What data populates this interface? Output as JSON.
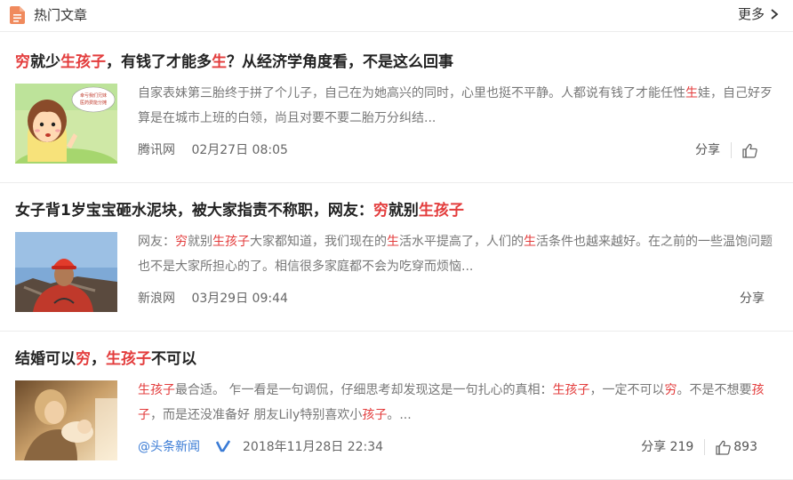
{
  "header": {
    "title": "热门文章",
    "more_label": "更多"
  },
  "colors": {
    "highlight": "#e33c3c",
    "source_link": "#3a7bd5",
    "accent_icon": "#f08a5d"
  },
  "articles": [
    {
      "title_segments": [
        {
          "text": "穷",
          "hl": true
        },
        {
          "text": "就少",
          "hl": false
        },
        {
          "text": "生孩子",
          "hl": true
        },
        {
          "text": "，有钱了才能多",
          "hl": false
        },
        {
          "text": "生",
          "hl": true
        },
        {
          "text": "？从经济学角度看，不是这么回事",
          "hl": false
        }
      ],
      "thumb_caption": "幸亏我们兄妹 医药费能分摊",
      "summary_segments": [
        {
          "text": "自家表妹第三胎终于拼了个儿子，自己在为她高兴的同时，心里也挺不平静。人都说有钱了才能任性",
          "hl": false
        },
        {
          "text": "生",
          "hl": true
        },
        {
          "text": "娃，自己好歹算是在城市上班的白领，尚且对要不要二胎万分纠结...",
          "hl": false
        }
      ],
      "source": "腾讯网",
      "time": "02月27日 08:05",
      "share_label": "分享",
      "like_count": ""
    },
    {
      "title_segments": [
        {
          "text": "女子背1岁宝宝砸水泥块，被大家指责不称职，网友：",
          "hl": false
        },
        {
          "text": "穷",
          "hl": true
        },
        {
          "text": "就别",
          "hl": false
        },
        {
          "text": "生孩子",
          "hl": true
        }
      ],
      "summary_segments": [
        {
          "text": "网友：",
          "hl": false
        },
        {
          "text": "穷",
          "hl": true
        },
        {
          "text": "就别",
          "hl": false
        },
        {
          "text": "生孩子",
          "hl": true
        },
        {
          "text": "大家都知道，我们现在的",
          "hl": false
        },
        {
          "text": "生",
          "hl": true
        },
        {
          "text": "活水平提高了，人们的",
          "hl": false
        },
        {
          "text": "生",
          "hl": true
        },
        {
          "text": "活条件也越来越好。在之前的一些温饱问题也不是大家所担心的了。相信很多家庭都不会为吃穿而烦恼...",
          "hl": false
        }
      ],
      "source": "新浪网",
      "time": "03月29日 09:44",
      "share_label": "分享"
    },
    {
      "title_segments": [
        {
          "text": "结婚可以",
          "hl": false
        },
        {
          "text": "穷",
          "hl": true
        },
        {
          "text": "，",
          "hl": false
        },
        {
          "text": "生孩子",
          "hl": true
        },
        {
          "text": "不可以",
          "hl": false
        }
      ],
      "summary_segments": [
        {
          "text": "生孩子",
          "hl": true
        },
        {
          "text": "最合适。 乍一看是一句调侃，仔细思考却发现这是一句扎心的真相：",
          "hl": false
        },
        {
          "text": "生孩子",
          "hl": true
        },
        {
          "text": "，一定不可以",
          "hl": false
        },
        {
          "text": "穷",
          "hl": true
        },
        {
          "text": "。不是不想要",
          "hl": false
        },
        {
          "text": "孩子",
          "hl": true
        },
        {
          "text": "，而是还没准备好 朋友Lily特别喜欢小",
          "hl": false
        },
        {
          "text": "孩子",
          "hl": true
        },
        {
          "text": "。...",
          "hl": false
        }
      ],
      "source": "@头条新闻",
      "time": "2018年11月28日 22:34",
      "share_label": "分享 219",
      "like_count": "893"
    }
  ]
}
